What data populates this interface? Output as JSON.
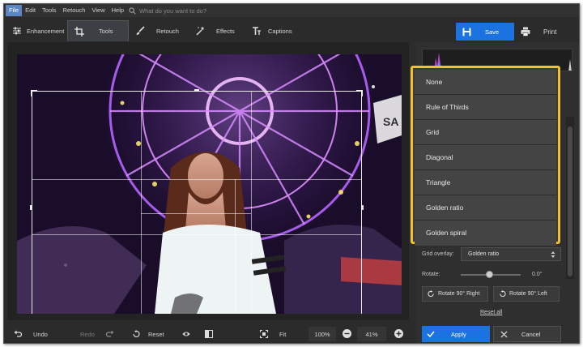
{
  "menubar": {
    "items": [
      "File",
      "Edit",
      "Tools",
      "Retouch",
      "View",
      "Help"
    ],
    "active_index": 0,
    "search_placeholder": "What do you want to do?"
  },
  "tabs": [
    {
      "label": "Enhancement",
      "icon": "sliders-icon"
    },
    {
      "label": "Tools",
      "icon": "crop-icon",
      "active": true
    },
    {
      "label": "Retouch",
      "icon": "brush-icon"
    },
    {
      "label": "Effects",
      "icon": "magic-wand-icon"
    },
    {
      "label": "Captions",
      "icon": "text-icon"
    }
  ],
  "toolbar": {
    "save_label": "Save",
    "print_label": "Print"
  },
  "photo": {
    "sign_text": "SA"
  },
  "grid_overlay_dropdown": {
    "options": [
      "None",
      "Rule of Thirds",
      "Grid",
      "Diagonal",
      "Triangle",
      "Golden ratio",
      "Golden spiral"
    ]
  },
  "panel": {
    "grid_overlay_label": "Grid overlay:",
    "grid_overlay_value": "Golden ratio",
    "rotate_label": "Rotate:",
    "rotate_value": "0.0°",
    "rotate_right_label": "Rotate 90° Right",
    "rotate_left_label": "Rotate 90° Left",
    "reset_all_label": "Reset all",
    "apply_label": "Apply",
    "cancel_label": "Cancel"
  },
  "bottombar": {
    "undo_label": "Undo",
    "redo_label": "Redo",
    "reset_label": "Reset",
    "fit_label": "Fit",
    "zoom_100_label": "100%",
    "zoom_value": "41%"
  },
  "colors": {
    "accent_blue": "#1a73e0",
    "highlight_yellow": "#f2c22a",
    "background_dark": "#2b2b2b"
  }
}
